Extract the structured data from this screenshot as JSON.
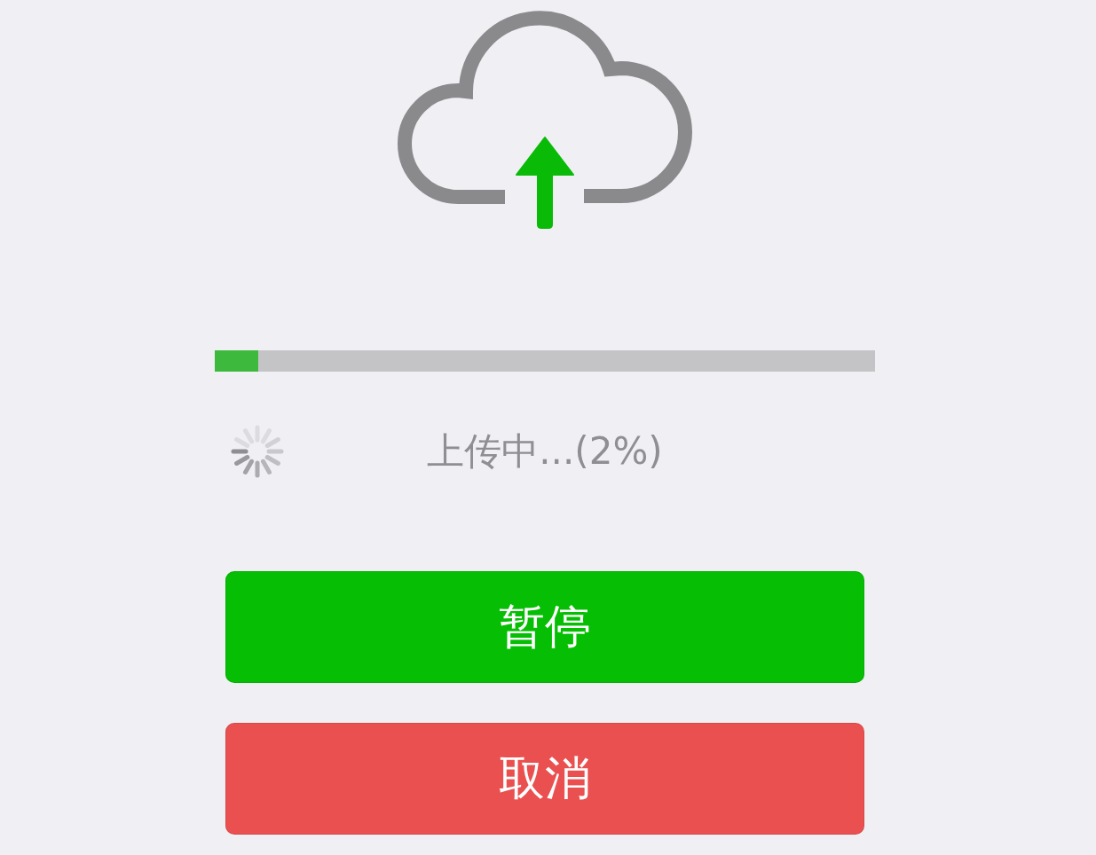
{
  "progress": {
    "level": 0.066
  },
  "status": {
    "text": "上传中...(2%)"
  },
  "buttons": [
    {
      "label": "暂停",
      "kind": "primary"
    },
    {
      "label": "取消",
      "kind": "warn"
    }
  ]
}
